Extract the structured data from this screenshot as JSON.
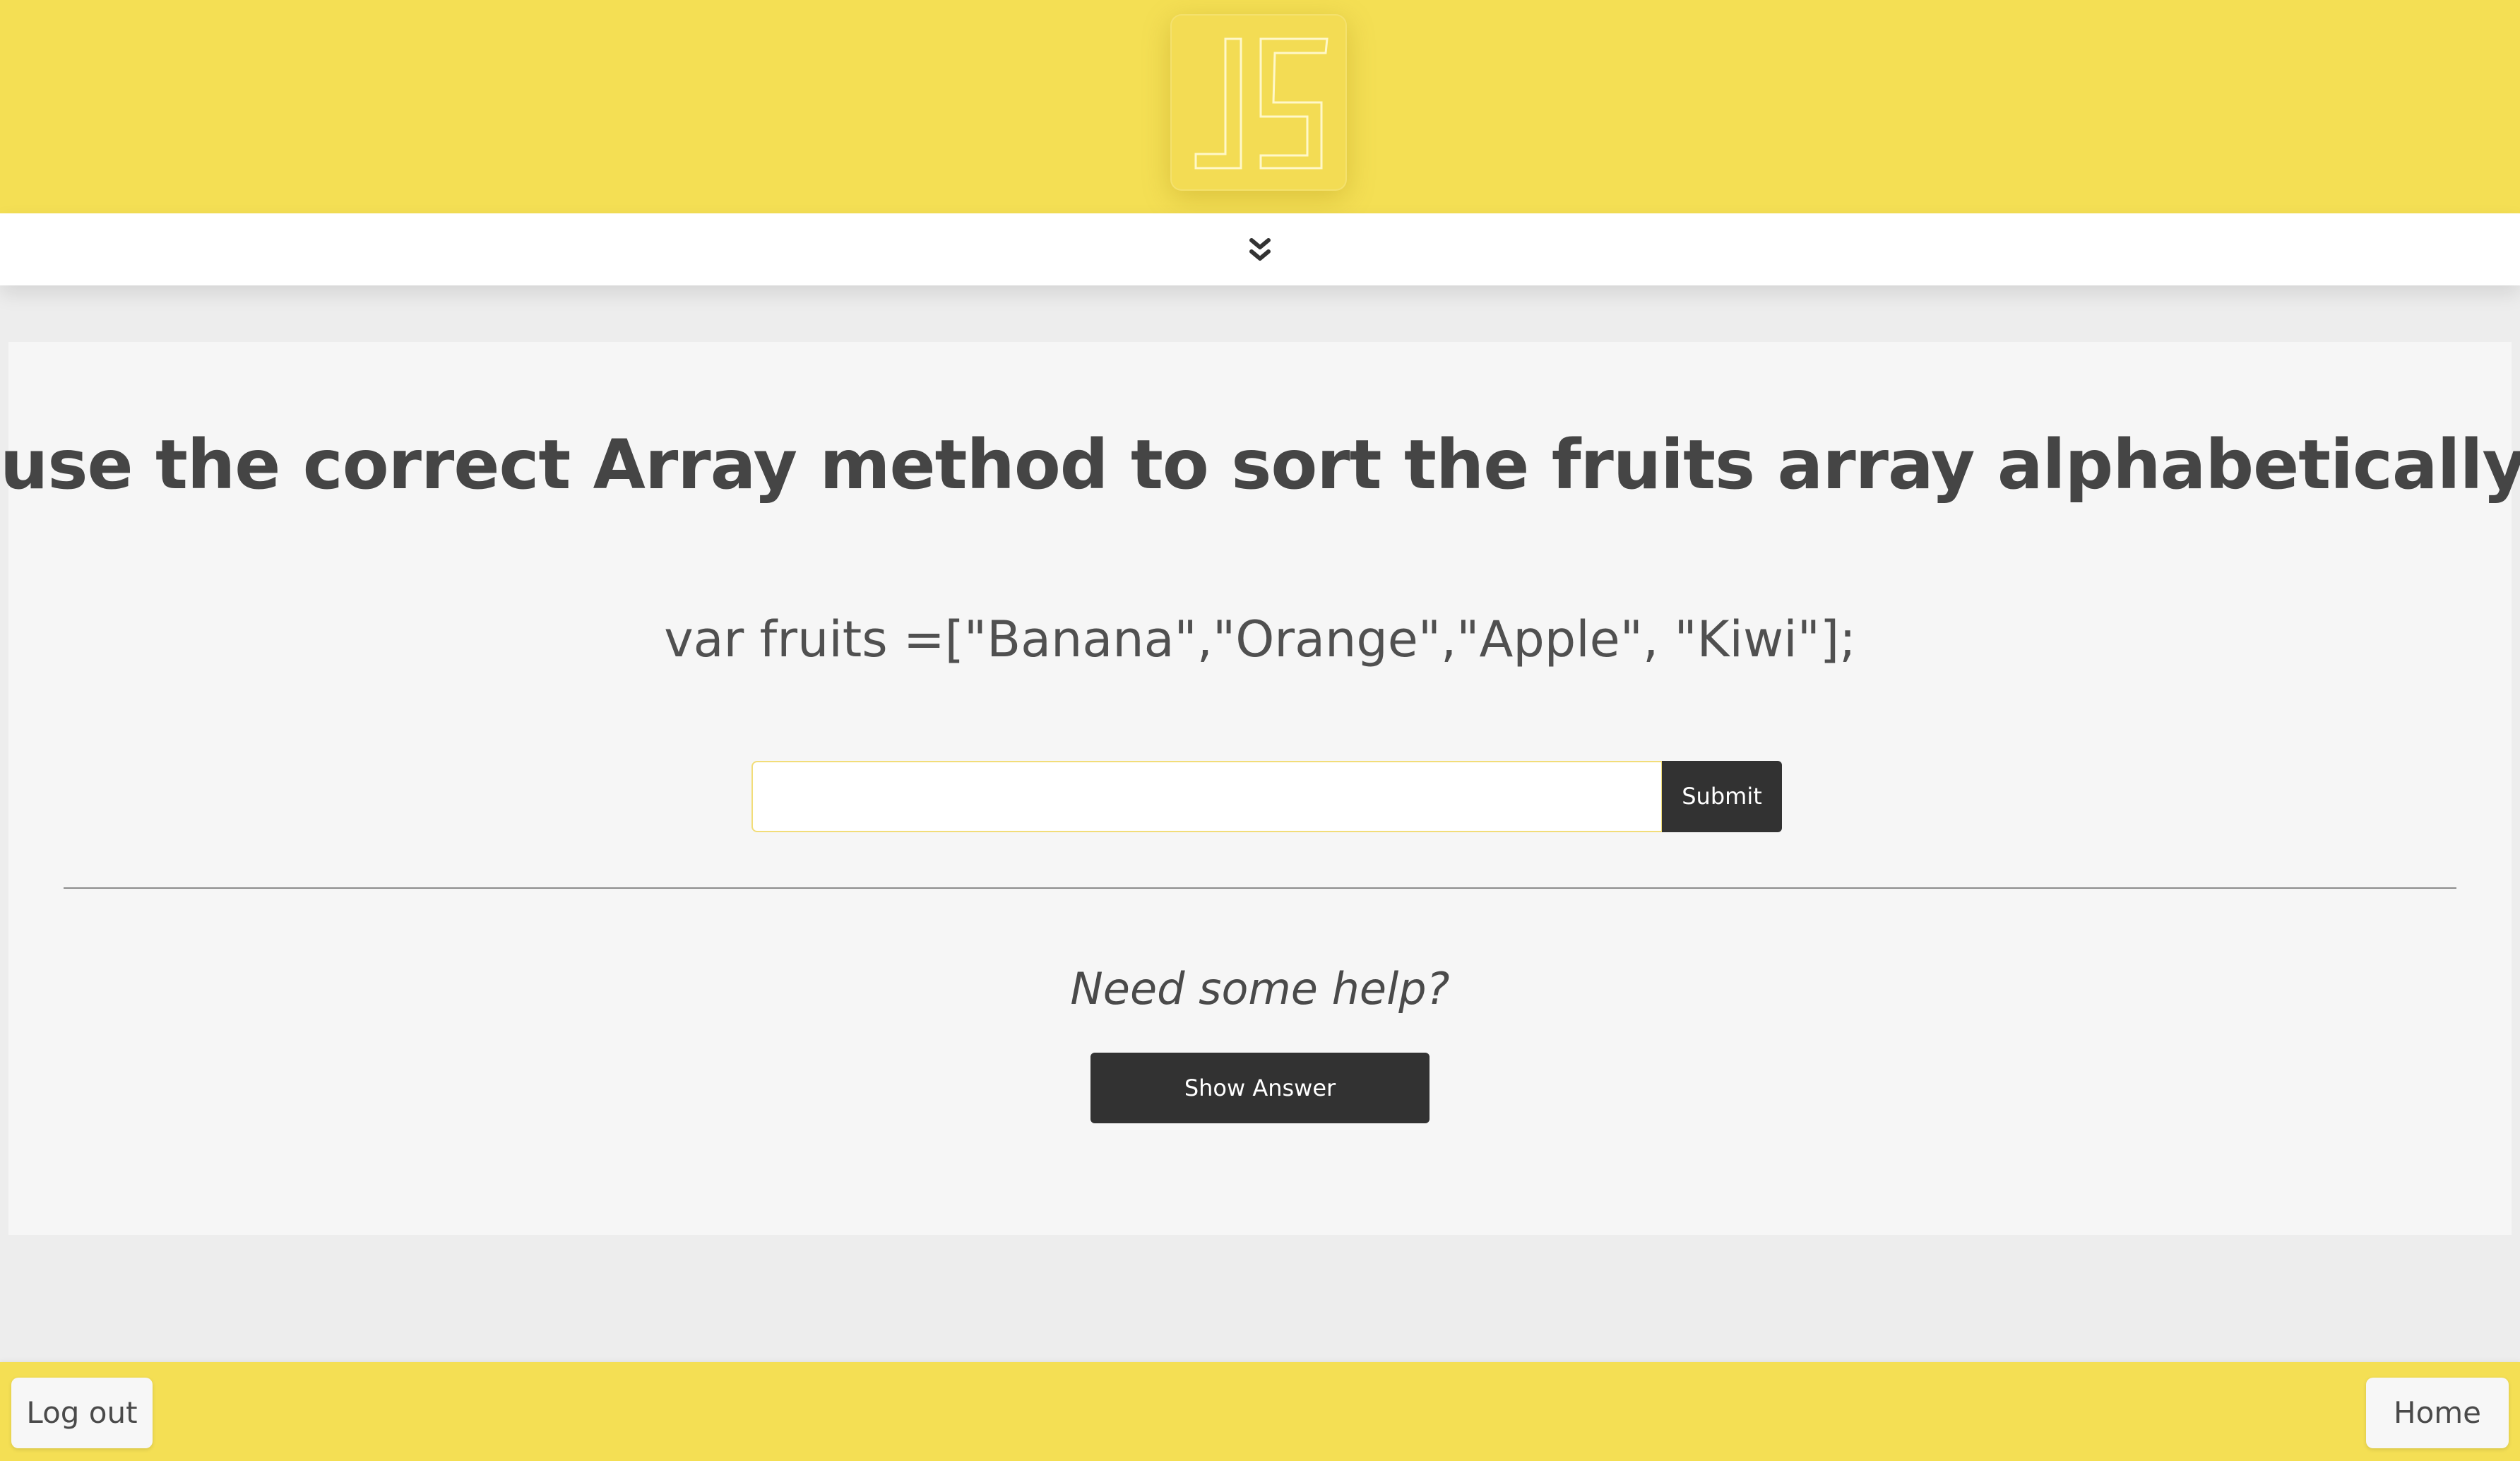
{
  "header": {
    "logo_icon": "js-logo-icon",
    "accent_color": "#f4df54"
  },
  "toggle": {
    "icon": "double-chevron-down-icon"
  },
  "exercise": {
    "question": "use the correct Array method to sort the fruits array alphabetically",
    "code": "var fruits =[\"Banana\",\"Orange\",\"Apple\", \"Kiwi\"];",
    "answer_value": "",
    "answer_placeholder": "",
    "submit_label": "Submit"
  },
  "help": {
    "text": "Need some help?",
    "show_answer_label": "Show Answer"
  },
  "footer": {
    "logout_label": "Log out",
    "home_label": "Home"
  }
}
